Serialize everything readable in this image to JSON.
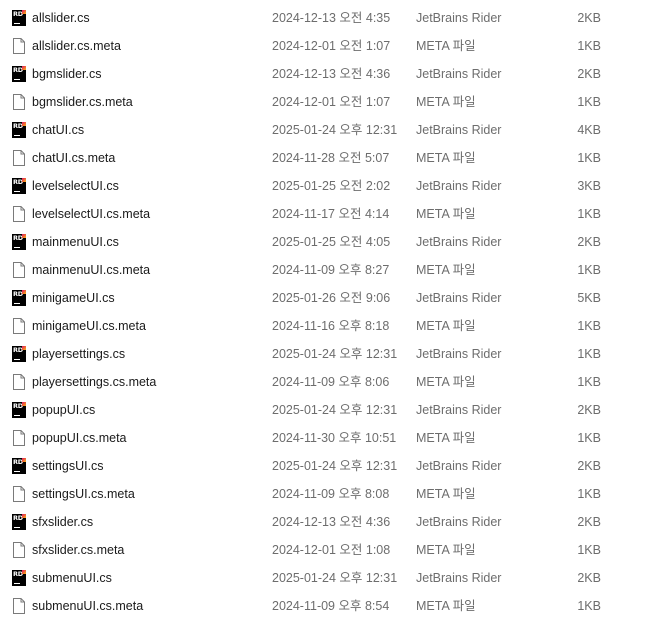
{
  "colors": {
    "rider_icon_bg": "#000000",
    "rider_accent": "#dd1265",
    "text": "#1a1a1a",
    "secondary_text": "#6d6d6d"
  },
  "files": [
    {
      "name": "allslider.cs",
      "date": "2024-12-13 오전 4:35",
      "type": "JetBrains Rider",
      "size": "2KB",
      "icon": "rider-file-icon",
      "icon_text": "RD"
    },
    {
      "name": "allslider.cs.meta",
      "date": "2024-12-01 오전 1:07",
      "type": "META 파일",
      "size": "1KB",
      "icon": "document-icon"
    },
    {
      "name": "bgmslider.cs",
      "date": "2024-12-13 오전 4:36",
      "type": "JetBrains Rider",
      "size": "2KB",
      "icon": "rider-file-icon",
      "icon_text": "RD"
    },
    {
      "name": "bgmslider.cs.meta",
      "date": "2024-12-01 오전 1:07",
      "type": "META 파일",
      "size": "1KB",
      "icon": "document-icon"
    },
    {
      "name": "chatUI.cs",
      "date": "2025-01-24 오후 12:31",
      "type": "JetBrains Rider",
      "size": "4KB",
      "icon": "rider-file-icon",
      "icon_text": "RD"
    },
    {
      "name": "chatUI.cs.meta",
      "date": "2024-11-28 오전 5:07",
      "type": "META 파일",
      "size": "1KB",
      "icon": "document-icon"
    },
    {
      "name": "levelselectUI.cs",
      "date": "2025-01-25 오전 2:02",
      "type": "JetBrains Rider",
      "size": "3KB",
      "icon": "rider-file-icon",
      "icon_text": "RD"
    },
    {
      "name": "levelselectUI.cs.meta",
      "date": "2024-11-17 오전 4:14",
      "type": "META 파일",
      "size": "1KB",
      "icon": "document-icon"
    },
    {
      "name": "mainmenuUI.cs",
      "date": "2025-01-25 오전 4:05",
      "type": "JetBrains Rider",
      "size": "2KB",
      "icon": "rider-file-icon",
      "icon_text": "RD"
    },
    {
      "name": "mainmenuUI.cs.meta",
      "date": "2024-11-09 오후 8:27",
      "type": "META 파일",
      "size": "1KB",
      "icon": "document-icon"
    },
    {
      "name": "minigameUI.cs",
      "date": "2025-01-26 오전 9:06",
      "type": "JetBrains Rider",
      "size": "5KB",
      "icon": "rider-file-icon",
      "icon_text": "RD"
    },
    {
      "name": "minigameUI.cs.meta",
      "date": "2024-11-16 오후 8:18",
      "type": "META 파일",
      "size": "1KB",
      "icon": "document-icon"
    },
    {
      "name": "playersettings.cs",
      "date": "2025-01-24 오후 12:31",
      "type": "JetBrains Rider",
      "size": "1KB",
      "icon": "rider-file-icon",
      "icon_text": "RD"
    },
    {
      "name": "playersettings.cs.meta",
      "date": "2024-11-09 오후 8:06",
      "type": "META 파일",
      "size": "1KB",
      "icon": "document-icon"
    },
    {
      "name": "popupUI.cs",
      "date": "2025-01-24 오후 12:31",
      "type": "JetBrains Rider",
      "size": "2KB",
      "icon": "rider-file-icon",
      "icon_text": "RD"
    },
    {
      "name": "popupUI.cs.meta",
      "date": "2024-11-30 오후 10:51",
      "type": "META 파일",
      "size": "1KB",
      "icon": "document-icon"
    },
    {
      "name": "settingsUI.cs",
      "date": "2025-01-24 오후 12:31",
      "type": "JetBrains Rider",
      "size": "2KB",
      "icon": "rider-file-icon",
      "icon_text": "RD"
    },
    {
      "name": "settingsUI.cs.meta",
      "date": "2024-11-09 오후 8:08",
      "type": "META 파일",
      "size": "1KB",
      "icon": "document-icon"
    },
    {
      "name": "sfxslider.cs",
      "date": "2024-12-13 오전 4:36",
      "type": "JetBrains Rider",
      "size": "2KB",
      "icon": "rider-file-icon",
      "icon_text": "RD"
    },
    {
      "name": "sfxslider.cs.meta",
      "date": "2024-12-01 오전 1:08",
      "type": "META 파일",
      "size": "1KB",
      "icon": "document-icon"
    },
    {
      "name": "submenuUI.cs",
      "date": "2025-01-24 오후 12:31",
      "type": "JetBrains Rider",
      "size": "2KB",
      "icon": "rider-file-icon",
      "icon_text": "RD"
    },
    {
      "name": "submenuUI.cs.meta",
      "date": "2024-11-09 오후 8:54",
      "type": "META 파일",
      "size": "1KB",
      "icon": "document-icon"
    }
  ]
}
